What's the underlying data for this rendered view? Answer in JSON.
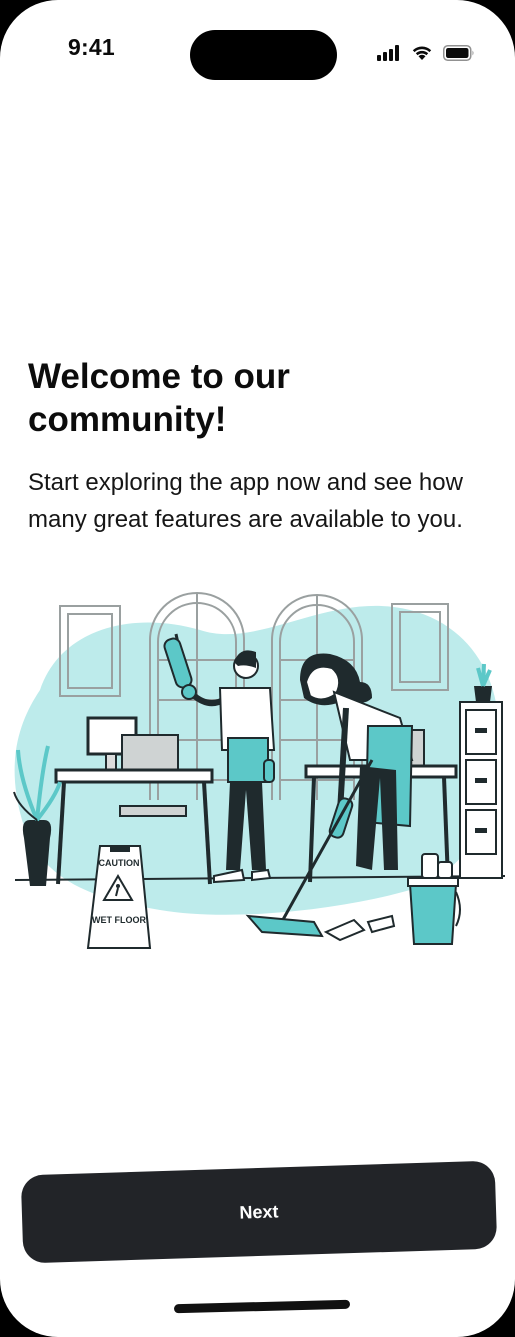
{
  "status_bar": {
    "time": "9:41",
    "icons": [
      "cellular-signal-icon",
      "wifi-icon",
      "battery-icon"
    ]
  },
  "onboarding": {
    "title": "Welcome to our community!",
    "subtitle": "Start exploring the app now and see how many great features are available to you.",
    "illustration": {
      "sign_line1": "CAUTION",
      "sign_line2": "WET FLOOR"
    },
    "next_label": "Next"
  },
  "colors": {
    "accent": "#5cc8c8",
    "accent_light": "#bdebeb",
    "button": "#222428",
    "text": "#0c0c0c",
    "background": "#ffffff"
  }
}
